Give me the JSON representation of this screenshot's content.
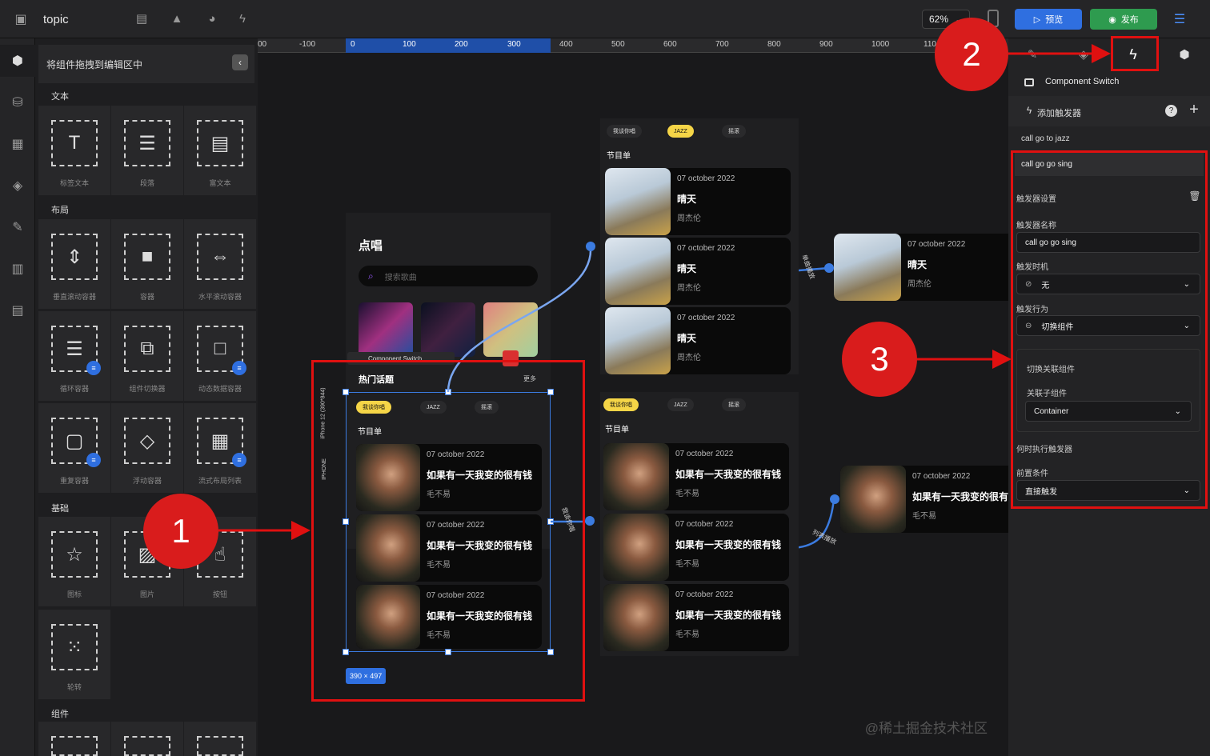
{
  "app": {
    "title": "topic",
    "zoom": "62%",
    "preview_label": "预览",
    "publish_label": "发布"
  },
  "left_panel": {
    "header": "将组件拖拽到编辑区中",
    "sections": {
      "text": "文本",
      "layout": "布局",
      "basic": "基础",
      "components": "组件"
    },
    "text_items": [
      "标签文本",
      "段落",
      "富文本"
    ],
    "layout_items": [
      "垂直滚动容器",
      "容器",
      "水平滚动容器",
      "循环容器",
      "组件切换器",
      "动态数据容器",
      "重复容器",
      "浮动容器",
      "流式布局列表"
    ],
    "basic_items": [
      "图标",
      "图片",
      "按钮",
      "轮转"
    ]
  },
  "ruler": {
    "ticks": [
      "00",
      "-100",
      "0",
      "100",
      "200",
      "300",
      "400",
      "500",
      "600",
      "700",
      "800",
      "900",
      "1000",
      "110"
    ]
  },
  "canvas": {
    "main_frame": {
      "title": "点唱",
      "search_placeholder": "搜索歌曲",
      "hot_topics": "热门话题",
      "more": "更多",
      "device_label": "IPHONE",
      "device_model": "iPhone 12 (390*844)",
      "component_switch_tag": "Component Switch",
      "size_badge": "390 × 497",
      "tabs": [
        "我谈你唱",
        "JAZZ",
        "摇滚"
      ],
      "playlist_label": "节目单",
      "songs": [
        {
          "date": "07 october 2022",
          "title": "如果有一天我变的很有钱",
          "artist": "毛不易"
        },
        {
          "date": "07 october 2022",
          "title": "如果有一天我变的很有钱",
          "artist": "毛不易"
        },
        {
          "date": "07 october 2022",
          "title": "如果有一天我变的很有钱",
          "artist": "毛不易"
        }
      ],
      "connector_label": "我谈你唱"
    },
    "jazz_frame": {
      "tabs": [
        "我谈你唱",
        "JAZZ",
        "摇滚"
      ],
      "playlist_label": "节目单",
      "songs": [
        {
          "date": "07 october 2022",
          "title": "晴天",
          "artist": "周杰伦"
        },
        {
          "date": "07 october 2022",
          "title": "晴天",
          "artist": "周杰伦"
        },
        {
          "date": "07 october 2022",
          "title": "晴天",
          "artist": "周杰伦"
        }
      ],
      "connector_label": "单曲播放"
    },
    "jazz_detail": {
      "date": "07 october 2022",
      "title": "晴天",
      "artist": "周杰伦"
    },
    "sing_frame": {
      "tabs": [
        "我谈你唱",
        "JAZZ",
        "摇滚"
      ],
      "playlist_label": "节目单",
      "songs": [
        {
          "date": "07 october 2022",
          "title": "如果有一天我变的很有钱",
          "artist": "毛不易"
        },
        {
          "date": "07 october 2022",
          "title": "如果有一天我变的很有钱",
          "artist": "毛不易"
        },
        {
          "date": "07 october 2022",
          "title": "如果有一天我变的很有钱",
          "artist": "毛不易"
        }
      ],
      "connector_label": "列表播放"
    },
    "sing_detail": {
      "date": "07 october 2022",
      "title": "如果有一天我变的很有钱",
      "artist": "毛不易"
    }
  },
  "right_panel": {
    "component_name": "Component Switch",
    "add_trigger": "添加触发器",
    "triggers": [
      "call go to jazz",
      "call go go sing"
    ],
    "trigger_settings": "触发器设置",
    "trigger_name_label": "触发器名称",
    "trigger_name_value": "call go go sing",
    "trigger_timing_label": "触发时机",
    "trigger_timing_value": "无",
    "trigger_action_label": "触发行为",
    "trigger_action_value": "切换组件",
    "switch_section_title": "切换关联组件",
    "related_label": "关联子组件",
    "related_value": "Container",
    "when_label": "何时执行触发器",
    "precondition_label": "前置条件",
    "precondition_value": "直接触发"
  },
  "annotations": {
    "one": "1",
    "two": "2",
    "three": "3"
  },
  "watermark": "@稀土掘金技术社区",
  "colors": {
    "accent_blue": "#2f6fe0",
    "publish_green": "#2e9b4f",
    "highlight_red": "#e01010",
    "tab_yellow": "#f5d547"
  }
}
